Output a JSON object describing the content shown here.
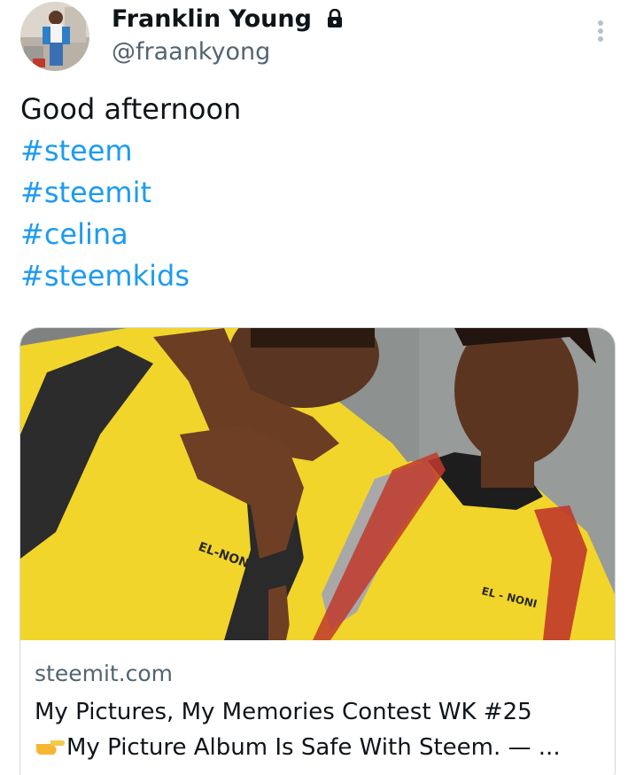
{
  "author": {
    "name": "Franklin Young",
    "handle": "@fraankyong",
    "avatar_icon": "profile-photo",
    "protected_icon": "lock-icon"
  },
  "tweet": {
    "lines": [
      {
        "text": "Good afternoon",
        "type": "text"
      },
      {
        "text": "#steem",
        "type": "hashtag"
      },
      {
        "text": "#steemit",
        "type": "hashtag"
      },
      {
        "text": "#celina",
        "type": "hashtag"
      },
      {
        "text": "#steemkids",
        "type": "hashtag"
      }
    ]
  },
  "card": {
    "domain": "steemit.com",
    "title_line1": "My Pictures, My Memories Contest WK #25",
    "title_line2": "My Picture Album Is Safe With Steem. — ...",
    "title_emoji": "pointing-right-icon",
    "photo_text_left": "EL-NONI",
    "photo_text_right": "EL - NONI"
  },
  "menu": {
    "icon": "more-vertical-icon"
  },
  "colors": {
    "link": "#1d9bf0",
    "secondary": "#536471",
    "shirt_yellow": "#f2d52a",
    "wall_gray": "#8b8f8e"
  }
}
